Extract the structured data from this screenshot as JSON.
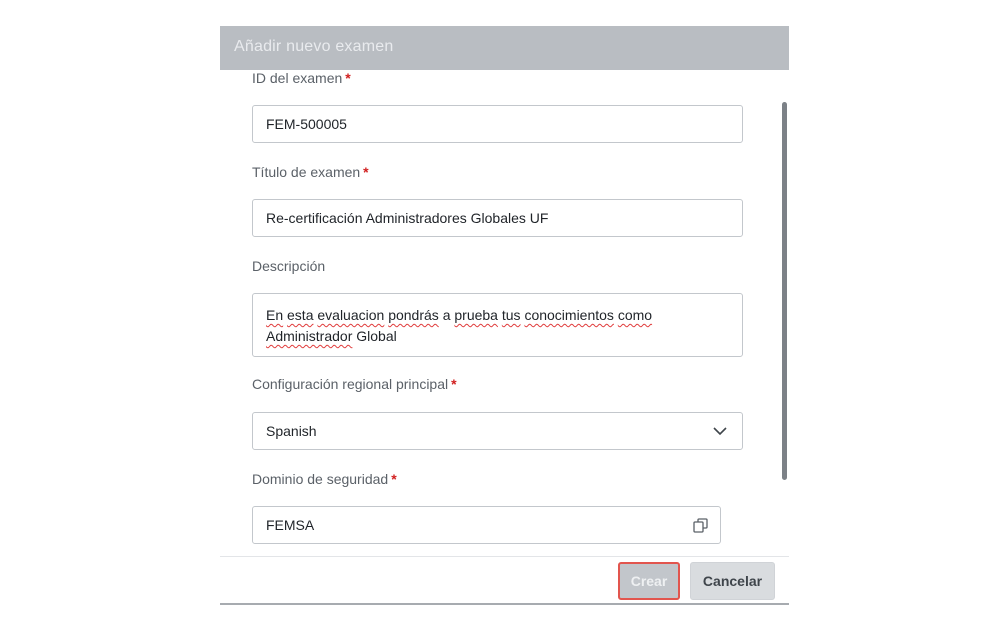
{
  "dialog": {
    "title": "Añadir nuevo examen"
  },
  "fields": {
    "exam_id": {
      "label": "ID del examen",
      "required_mark": "*",
      "value": "FEM-500005"
    },
    "exam_title": {
      "label": "Título de examen",
      "required_mark": "*",
      "value": "Re-certificación Administradores Globales UF"
    },
    "description": {
      "label": "Descripción",
      "words": [
        "En",
        "esta",
        "evaluacion",
        "pondrás",
        "a",
        "prueba",
        "tus",
        "conocimientos",
        "como",
        "Administrador",
        "Global"
      ]
    },
    "locale": {
      "label": "Configuración regional principal",
      "required_mark": "*",
      "value": "Spanish",
      "icon": "chevron-down-icon"
    },
    "security_domain": {
      "label": "Dominio de seguridad",
      "required_mark": "*",
      "value": "FEMSA",
      "icon": "copy-icon"
    }
  },
  "footer": {
    "create_label": "Crear",
    "cancel_label": "Cancelar"
  },
  "colors": {
    "header_bg": "#b9bdc2",
    "required": "#d11f1f",
    "highlight_border": "#e2554e",
    "spellcheck": "#e03b3b"
  }
}
